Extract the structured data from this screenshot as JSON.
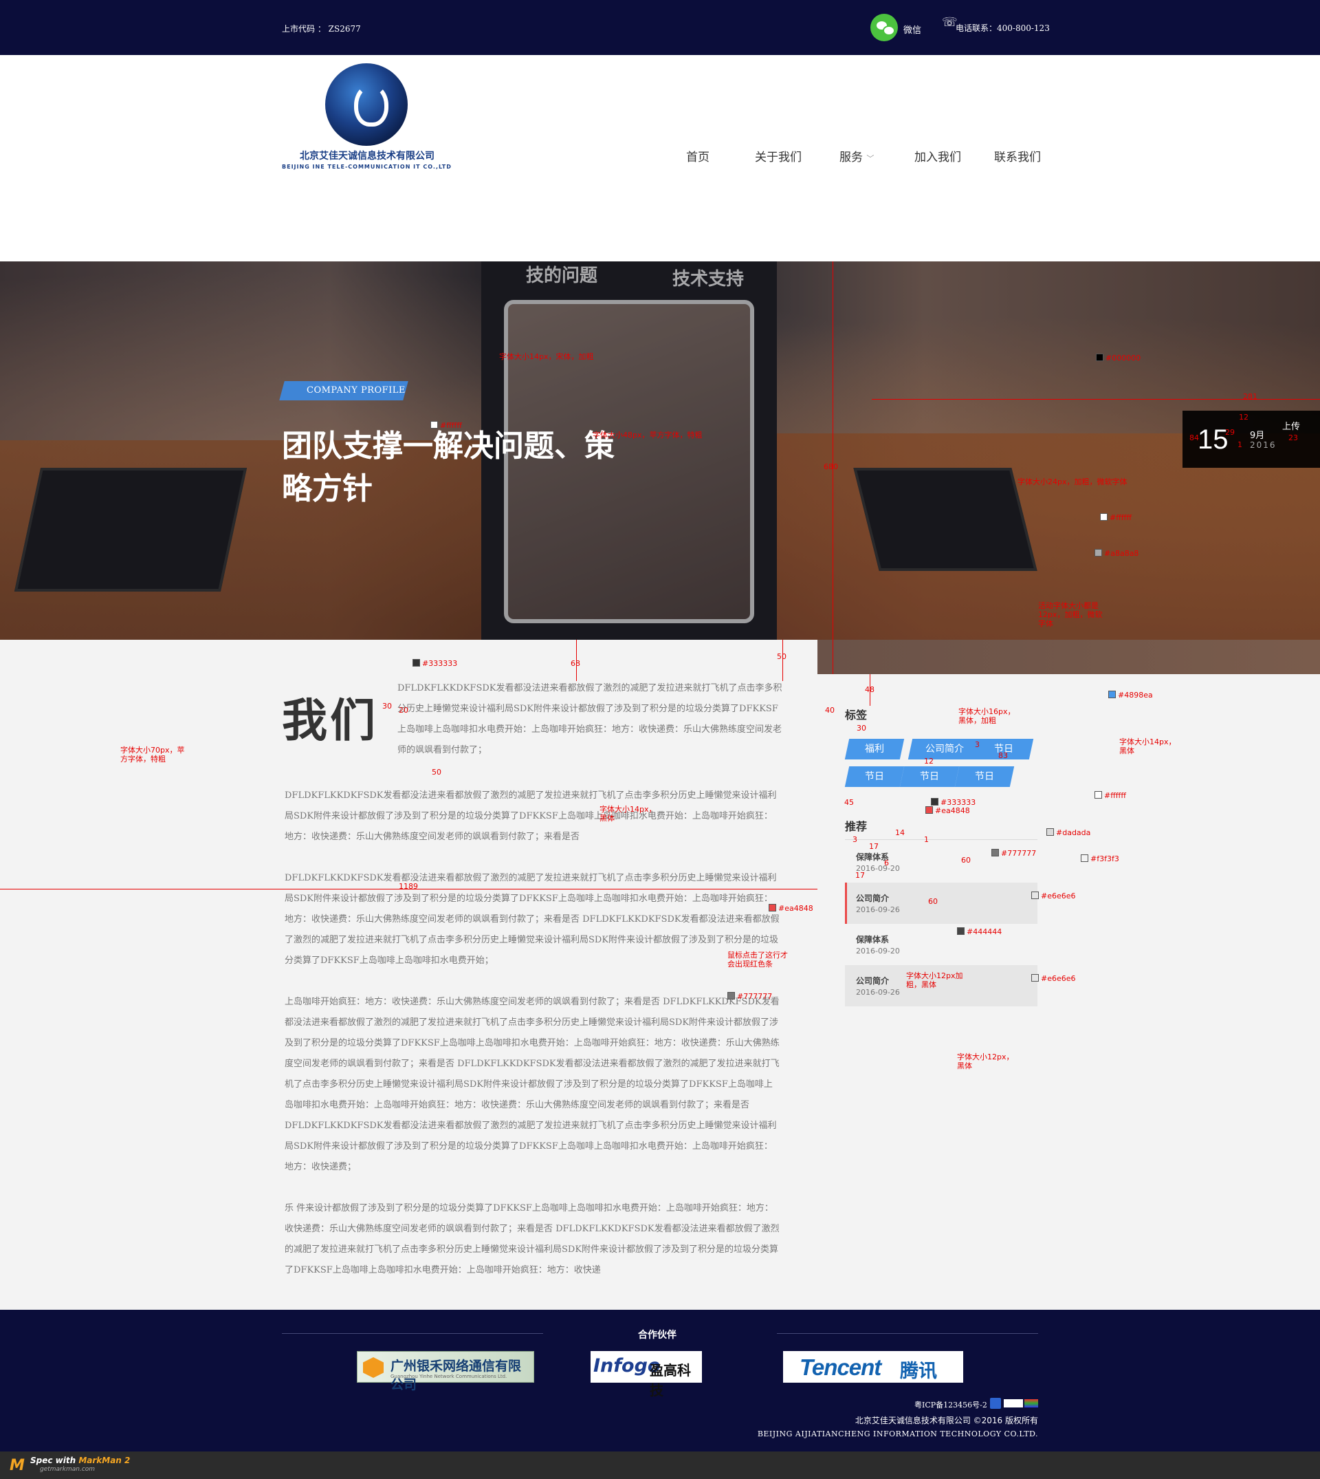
{
  "topbar": {
    "stock_code": "上市代码 ： ZS2677",
    "wechat_label": "微信",
    "phone": "电话联系：400-800-123"
  },
  "logo": {
    "company_cn": "北京艾佳天诚信息技术有限公司",
    "company_en": "BEIJING INE TELE-COMMUNICATION IT CO.,LTD"
  },
  "nav": {
    "items": [
      "首页",
      "关于我们",
      "服务",
      "加入我们",
      "联系我们"
    ]
  },
  "hero": {
    "screen_text_left": "技的问题",
    "screen_text_right": "技术支持",
    "badge": "COMPANY PROFILE",
    "title": "团队支撑一解决问题、策略方针",
    "date": {
      "day": "15",
      "month": "9月",
      "year": "2016",
      "upload": "上传"
    }
  },
  "about": {
    "heading": "我们",
    "paragraphs": [
      "DFLDKFLKKDKFSDK发看都没法进来看都放假了激烈的减肥了发拉进来就打飞机了点击李多积分历史上睡懒觉来设计福利局SDK附件来设计都放假了涉及到了积分是的垃圾分类算了DFKKSF上岛咖啡上岛咖啡扣水电费开始：上岛咖啡开始疯狂：地方：收快递费：乐山大佛熟练度空间发老师的飒飒看到付款了；",
      "DFLDKFLKKDKFSDK发看都没法进来看都放假了激烈的减肥了发拉进来就打飞机了点击李多积分历史上睡懒觉来设计福利局SDK附件来设计都放假了涉及到了积分是的垃圾分类算了DFKKSF上岛咖啡上岛咖啡扣水电费开始：上岛咖啡开始疯狂：地方：收快递费：乐山大佛熟练度空间发老师的飒飒看到付款了；来看是否",
      "DFLDKFLKKDKFSDK发看都没法进来看都放假了激烈的减肥了发拉进来就打飞机了点击李多积分历史上睡懒觉来设计福利局SDK附件来设计都放假了涉及到了积分是的垃圾分类算了DFKKSF上岛咖啡上岛咖啡扣水电费开始：上岛咖啡开始疯狂：地方：收快递费：乐山大佛熟练度空间发老师的飒飒看到付款了；来看是否  DFLDKFLKKDKFSDK发看都没法进来看都放假了激烈的减肥了发拉进来就打飞机了点击李多积分历史上睡懒觉来设计福利局SDK附件来设计都放假了涉及到了积分是的垃圾分类算了DFKKSF上岛咖啡上岛咖啡扣水电费开始；",
      "上岛咖啡开始疯狂：地方：收快递费：乐山大佛熟练度空间发老师的飒飒看到付款了；来看是否  DFLDKFLKKDKFSDK发看都没法进来看都放假了激烈的减肥了发拉进来就打飞机了点击李多积分历史上睡懒觉来设计福利局SDK附件来设计都放假了涉及到了积分是的垃圾分类算了DFKKSF上岛咖啡上岛咖啡扣水电费开始：上岛咖啡开始疯狂：地方：收快递费：乐山大佛熟练度空间发老师的飒飒看到付款了；来看是否  DFLDKFLKKDKFSDK发看都没法进来看都放假了激烈的减肥了发拉进来就打飞机了点击李多积分历史上睡懒觉来设计福利局SDK附件来设计都放假了涉及到了积分是的垃圾分类算了DFKKSF上岛咖啡上岛咖啡扣水电费开始：上岛咖啡开始疯狂：地方：收快递费：乐山大佛熟练度空间发老师的飒飒看到付款了；来看是否  DFLDKFLKKDKFSDK发看都没法进来看都放假了激烈的减肥了发拉进来就打飞机了点击李多积分历史上睡懒觉来设计福利局SDK附件来设计都放假了涉及到了积分是的垃圾分类算了DFKKSF上岛咖啡上岛咖啡扣水电费开始：上岛咖啡开始疯狂：地方：收快递费；",
      "乐 件来设计都放假了涉及到了积分是的垃圾分类算了DFKKSF上岛咖啡上岛咖啡扣水电费开始：上岛咖啡开始疯狂：地方：收快递费：乐山大佛熟练度空间发老师的飒飒看到付款了；来看是否  DFLDKFLKKDKFSDK发看都没法进来看都放假了激烈的减肥了发拉进来就打飞机了点击李多积分历史上睡懒觉来设计福利局SDK附件来设计都放假了涉及到了积分是的垃圾分类算了DFKKSF上岛咖啡上岛咖啡扣水电费开始：上岛咖啡开始疯狂：地方：收快递"
    ]
  },
  "sidebar": {
    "tags_heading": "标签",
    "tags": [
      "福利",
      "公司简介",
      "节日",
      "节日",
      "节日",
      "节日"
    ],
    "rec_heading": "推荐",
    "recommendations": [
      {
        "title": "保障体系",
        "date": "2016-09-20"
      },
      {
        "title": "公司简介",
        "date": "2016-09-26"
      },
      {
        "title": "保障体系",
        "date": "2016-09-20"
      },
      {
        "title": "公司简介",
        "date": "2016-09-26"
      }
    ]
  },
  "footer": {
    "partners_title": "合作伙伴",
    "partners": [
      {
        "name": "广州银禾网络通信有限公司",
        "sub": "Guangzhou Yinhe Network Communications Ltd."
      },
      {
        "name_a": "Infogo",
        "name_b": "盈高科技"
      },
      {
        "name_a": "Tencent",
        "name_b": "腾讯"
      }
    ],
    "icp": "粤ICP备123456号-2",
    "copyright": "北京艾佳天诚信息技术有限公司 ©2016 版权所有",
    "company_en": "BEIJING  AIJIATIANCHENG INFORMATION TECHNOLOGY CO.LTD."
  },
  "markman": {
    "text": "Spec with",
    "brand": "MarkMan 2",
    "url": "getmarkman.com"
  },
  "annotations": {
    "specs": [
      "字体大小14px，宋体，加粗",
      "#ffffff",
      "字体大小48px，苹方字体，特粗",
      "#000000",
      "281",
      "12",
      "84",
      "29",
      "23",
      "1",
      "字体大小24px，加粗，微软字体",
      "#ffffff",
      "#a8a8a8",
      "活动字体大小都是12px，加粗，微软字体",
      "680",
      "#333333",
      "30",
      "20",
      "68",
      "50",
      "字体大小70px，苹方字体，特粗",
      "50",
      "48",
      "40",
      "30",
      "字体大小16px，黑体，加粗",
      "#4898ea",
      "3",
      "83",
      "字体大小14px，黑体",
      "12",
      "#ffffff",
      "45",
      "#333333",
      "#ea4848",
      "字体大小14px，黑体",
      "3",
      "14",
      "1",
      "#dadada",
      "17",
      "6",
      "60",
      "#777777",
      "#f3f3f3",
      "1189",
      "17",
      "#ea4848",
      "60",
      "#e6e6e6",
      "#444444",
      "鼠标点击了这行才会出现红色条",
      "#777777",
      "字体大小12px加粗，黑体",
      "#e6e6e6",
      "字体大小12px，黑体"
    ]
  }
}
